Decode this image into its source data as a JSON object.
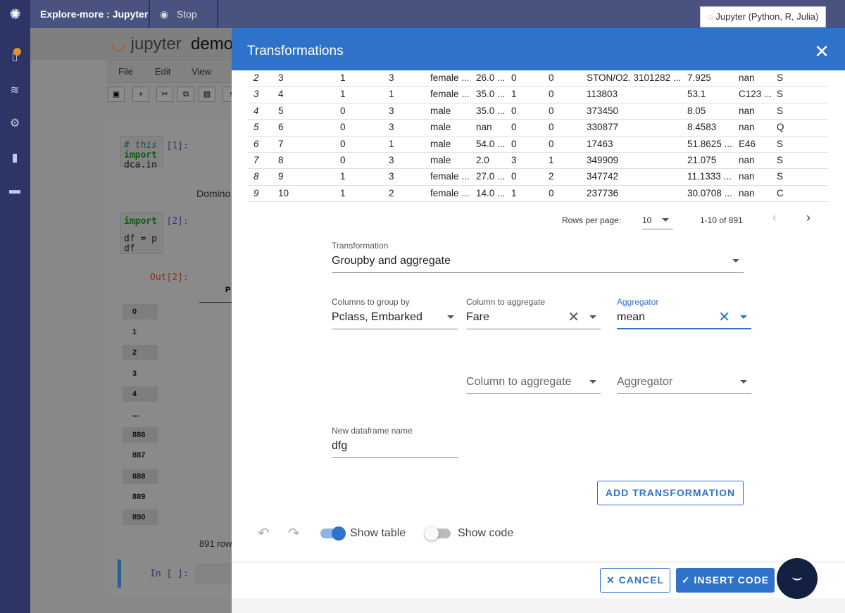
{
  "topbar": {
    "title": "Explore-more : Jupyter",
    "stop_label": "Stop",
    "kernel": "Jupyter (Python, R, Julia)"
  },
  "notebook": {
    "logo_text": "jupyter",
    "name": "demo",
    "menu": [
      "File",
      "Edit",
      "View"
    ],
    "cells": [
      {
        "prompt": "In [1]:",
        "lines": [
          "# this",
          "import",
          "dca.in"
        ],
        "output": "Domino"
      },
      {
        "prompt": "In [2]:",
        "lines": [
          "import",
          "",
          "df = p",
          "df"
        ]
      }
    ],
    "out_prompt": "Out[2]:",
    "col_header": "P",
    "row_index": [
      "0",
      "1",
      "2",
      "3",
      "4",
      "...",
      "886",
      "887",
      "888",
      "889",
      "890"
    ],
    "rows_text": "891 row",
    "empty_prompt": "In [ ]:"
  },
  "modal": {
    "title": "Transformations",
    "table": {
      "rows": [
        [
          "2",
          "3",
          "1",
          "3",
          "female ...",
          "26.0 ...",
          "0",
          "0",
          "STON/O2. 3101282 ...",
          "7.925",
          "nan",
          "S"
        ],
        [
          "3",
          "4",
          "1",
          "1",
          "female ...",
          "35.0 ...",
          "1",
          "0",
          "113803",
          "53.1",
          "C123 ...",
          "S"
        ],
        [
          "4",
          "5",
          "0",
          "3",
          "male",
          "35.0 ...",
          "0",
          "0",
          "373450",
          "8.05",
          "nan",
          "S"
        ],
        [
          "5",
          "6",
          "0",
          "3",
          "male",
          "nan",
          "0",
          "0",
          "330877",
          "8.4583",
          "nan",
          "Q"
        ],
        [
          "6",
          "7",
          "0",
          "1",
          "male",
          "54.0 ...",
          "0",
          "0",
          "17463",
          "51.8625 ...",
          "E46",
          "S"
        ],
        [
          "7",
          "8",
          "0",
          "3",
          "male",
          "2.0",
          "3",
          "1",
          "349909",
          "21.075",
          "nan",
          "S"
        ],
        [
          "8",
          "9",
          "1",
          "3",
          "female ...",
          "27.0 ...",
          "0",
          "2",
          "347742",
          "11.1333 ...",
          "nan",
          "S"
        ],
        [
          "9",
          "10",
          "1",
          "2",
          "female ...",
          "14.0 ...",
          "1",
          "0",
          "237736",
          "30.0708 ...",
          "nan",
          "C"
        ]
      ]
    },
    "pager": {
      "rows_per_page_label": "Rows per page:",
      "rows_per_page": "10",
      "range": "1-10 of 891"
    },
    "transformation": {
      "label": "Transformation",
      "value": "Groupby and aggregate"
    },
    "group_by": {
      "label": "Columns to group by",
      "value": "Pclass, Embarked"
    },
    "agg_col": {
      "label": "Column to aggregate",
      "value": "Fare"
    },
    "aggregator": {
      "label": "Aggregator",
      "value": "mean"
    },
    "agg_col2": {
      "placeholder": "Column to aggregate"
    },
    "aggregator2": {
      "placeholder": "Aggregator"
    },
    "df_name": {
      "label": "New dataframe name",
      "value": "dfg"
    },
    "add_button": "ADD TRANSFORMATION",
    "show_table": {
      "label": "Show table",
      "on": true
    },
    "show_code": {
      "label": "Show code",
      "on": false
    },
    "cancel": "CANCEL",
    "insert": "INSERT CODE"
  },
  "colors": {
    "accent": "#2f72c9",
    "topbar": "#4a5280",
    "sidebar": "#2c3566"
  }
}
